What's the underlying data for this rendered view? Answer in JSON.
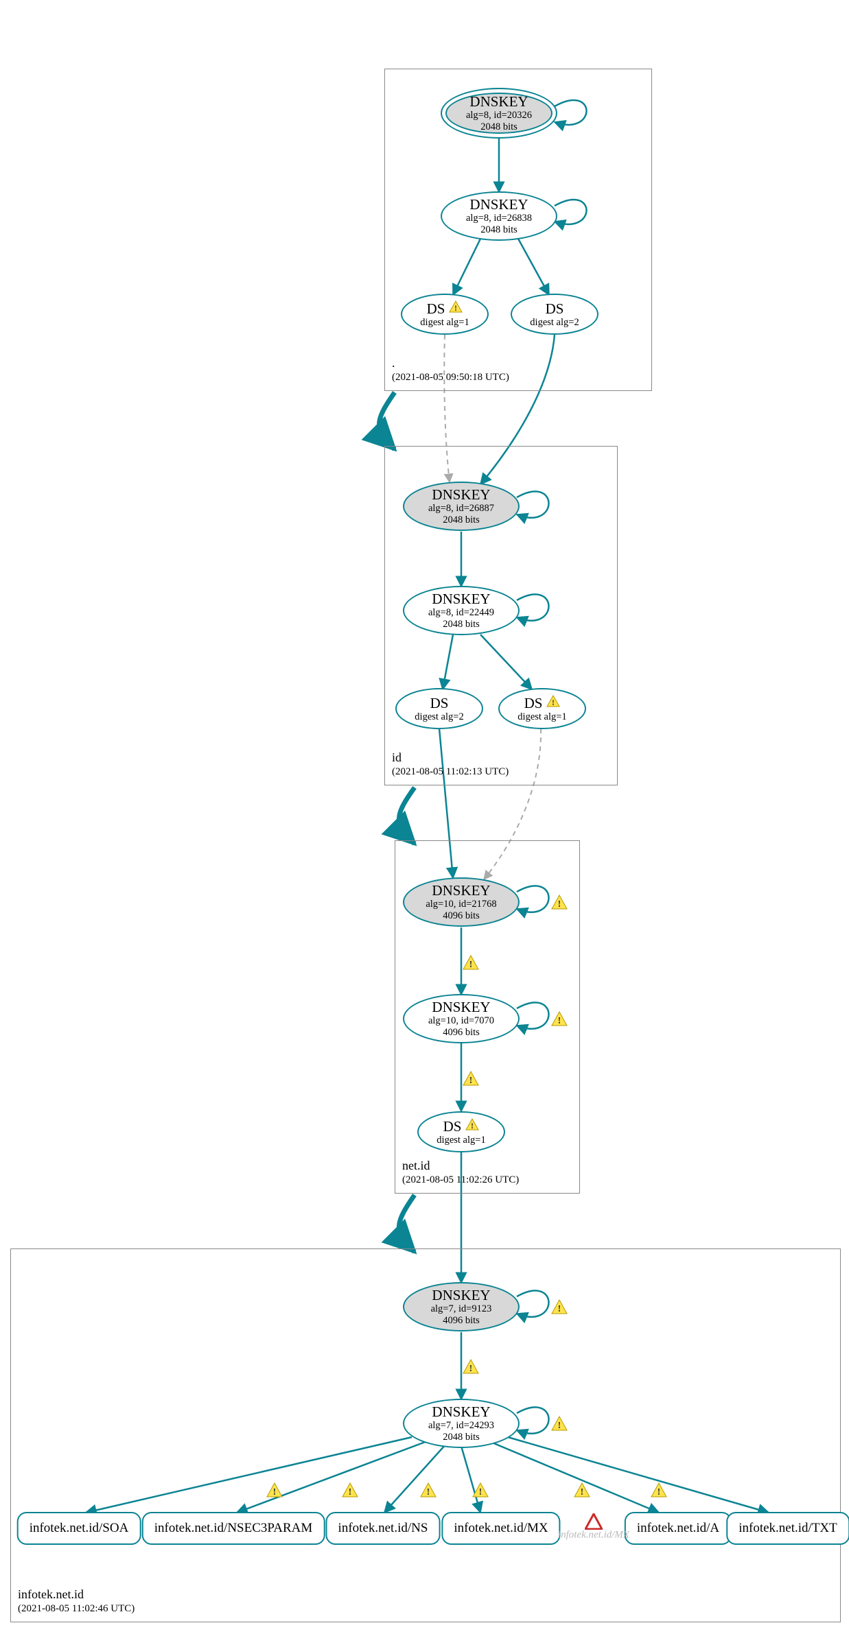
{
  "zones": {
    "root": {
      "name": ".",
      "timestamp": "(2021-08-05 09:50:18 UTC)"
    },
    "id": {
      "name": "id",
      "timestamp": "(2021-08-05 11:02:13 UTC)"
    },
    "netid": {
      "name": "net.id",
      "timestamp": "(2021-08-05 11:02:26 UTC)"
    },
    "leaf": {
      "name": "infotek.net.id",
      "timestamp": "(2021-08-05 11:02:46 UTC)"
    }
  },
  "nodes": {
    "root_ksk": {
      "title": "DNSKEY",
      "line2": "alg=8, id=20326",
      "line3": "2048 bits"
    },
    "root_zsk": {
      "title": "DNSKEY",
      "line2": "alg=8, id=26838",
      "line3": "2048 bits"
    },
    "root_ds1": {
      "title": "DS",
      "line2": "digest alg=1"
    },
    "root_ds2": {
      "title": "DS",
      "line2": "digest alg=2"
    },
    "id_ksk": {
      "title": "DNSKEY",
      "line2": "alg=8, id=26887",
      "line3": "2048 bits"
    },
    "id_zsk": {
      "title": "DNSKEY",
      "line2": "alg=8, id=22449",
      "line3": "2048 bits"
    },
    "id_ds2": {
      "title": "DS",
      "line2": "digest alg=2"
    },
    "id_ds1": {
      "title": "DS",
      "line2": "digest alg=1"
    },
    "netid_ksk": {
      "title": "DNSKEY",
      "line2": "alg=10, id=21768",
      "line3": "4096 bits"
    },
    "netid_zsk": {
      "title": "DNSKEY",
      "line2": "alg=10, id=7070",
      "line3": "4096 bits"
    },
    "netid_ds1": {
      "title": "DS",
      "line2": "digest alg=1"
    },
    "leaf_ksk": {
      "title": "DNSKEY",
      "line2": "alg=7, id=9123",
      "line3": "4096 bits"
    },
    "leaf_zsk": {
      "title": "DNSKEY",
      "line2": "alg=7, id=24293",
      "line3": "2048 bits"
    }
  },
  "rrsets": {
    "soa": "infotek.net.id/SOA",
    "n3p": "infotek.net.id/NSEC3PARAM",
    "ns": "infotek.net.id/NS",
    "mx": "infotek.net.id/MX",
    "a": "infotek.net.id/A",
    "txt": "infotek.net.id/TXT"
  },
  "extras": {
    "mx_error_label": "infotek.net.id/MX"
  },
  "colors": {
    "teal": "#0b8493",
    "gray_dash": "#aaaaaa"
  }
}
